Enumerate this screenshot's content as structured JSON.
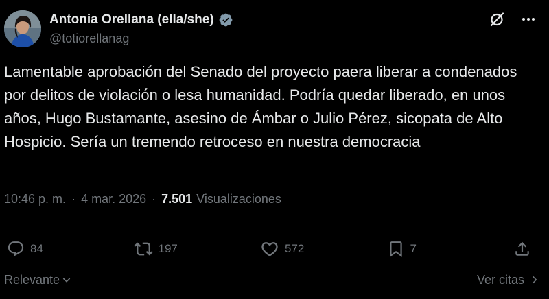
{
  "author": {
    "display_name": "Antonia Orellana (ella/she)",
    "handle": "@totiorellanag",
    "verified": true
  },
  "tweet": {
    "text": "Lamentable aprobación del Senado del proyecto paera liberar a condenados por delitos de violación o lesa humanidad. Podría quedar liberado, en unos años, Hugo Bustamante, asesino de Ámbar o Julio Pérez, sicopata de Alto Hospicio. Sería un tremendo retroceso en nuestra democracia"
  },
  "meta": {
    "time": "10:46 p. m.",
    "separator": "·",
    "date": "4 mar. 2026",
    "views_count": "7.501",
    "views_label": "Visualizaciones"
  },
  "actions": {
    "replies": "84",
    "reposts": "197",
    "likes": "572",
    "bookmarks": "7"
  },
  "footer": {
    "sort_label": "Relevante",
    "quotes_label": "Ver citas"
  },
  "icons": {
    "verified": "verified-badge-icon",
    "grok": "grok-icon",
    "more": "more-icon",
    "reply": "reply-icon",
    "repost": "repost-icon",
    "like": "heart-icon",
    "bookmark": "bookmark-icon",
    "share": "share-icon",
    "chevron_down": "chevron-down-icon",
    "chevron_right": "chevron-right-icon"
  },
  "colors": {
    "background": "#000000",
    "text": "#e7e9ea",
    "secondary": "#71767b",
    "divider": "#2f3336",
    "verified": "#829aab"
  }
}
